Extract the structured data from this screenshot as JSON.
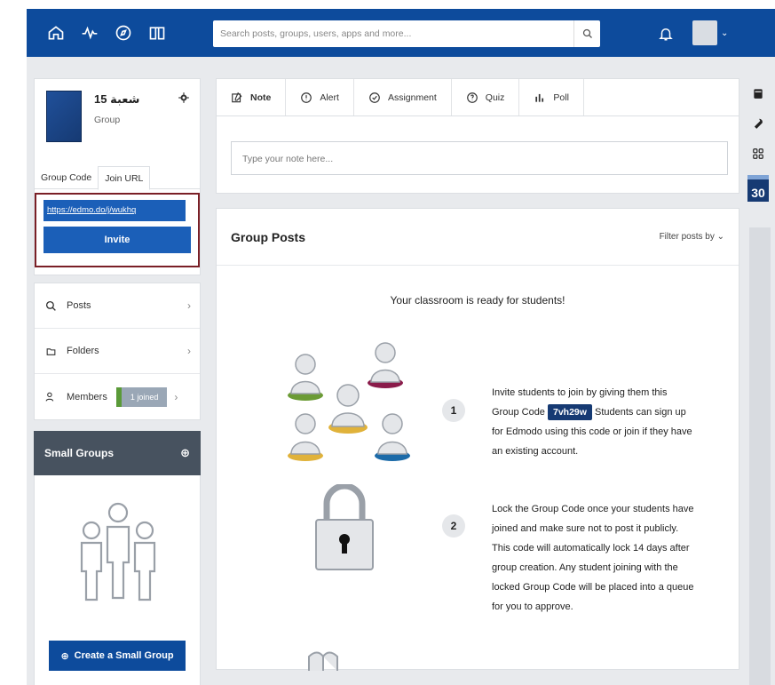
{
  "topbar": {
    "search_placeholder": "Search posts, groups, users, apps and more..."
  },
  "group": {
    "name": "شعبة 15",
    "type": "Group",
    "tabs": [
      "Group Code",
      "Join URL"
    ],
    "join_url": "https://edmo.do/j/wukhq",
    "invite_label": "Invite"
  },
  "menu": {
    "posts": "Posts",
    "folders": "Folders",
    "members": "Members",
    "members_badge": "1 joined"
  },
  "small_groups": {
    "title": "Small Groups",
    "create_label": "Create a Small Group"
  },
  "composer": {
    "tabs": [
      "Note",
      "Alert",
      "Assignment",
      "Quiz",
      "Poll"
    ],
    "placeholder": "Type your note here..."
  },
  "posts": {
    "title": "Group Posts",
    "filter": "Filter posts by",
    "ready": "Your classroom is ready for students!",
    "step1_num": "1",
    "step1_pre": "Invite students to join by giving them this Group Code",
    "step1_code": "7vh29w",
    "step1_post": "Students can sign up for Edmodo using this code or join if they have an existing account.",
    "step2_num": "2",
    "step2_text": "Lock the Group Code once your students have joined and make sure not to post it publicly. This code will automatically lock 14 days after group creation. Any student joining with the locked Group Code will be placed into a queue for you to approve."
  },
  "rail": {
    "calendar_day": "30"
  },
  "colors": {
    "nav": "#0d4b9c",
    "invite_border": "#7a1f26",
    "button": "#1b5fb8",
    "small_groups_head": "#47525f"
  }
}
